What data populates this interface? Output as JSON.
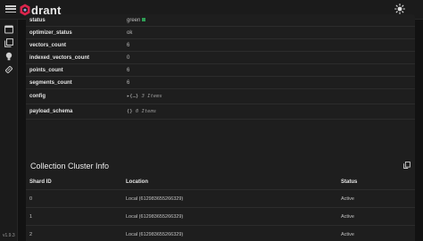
{
  "app": {
    "logo_text": "drant",
    "version": "v1.9.3"
  },
  "colors": {
    "accent": "#dc244c",
    "status_green": "#2e9e55"
  },
  "icons": [
    "menu-icon",
    "qdrant-logo",
    "sun-icon",
    "console-icon",
    "collections-icon",
    "tutorial-icon",
    "datasets-icon",
    "copy-icon"
  ],
  "collection_info": [
    {
      "key": "status",
      "value": "green",
      "indicator": "green-dot"
    },
    {
      "key": "optimizer_status",
      "value": "ok"
    },
    {
      "key": "vectors_count",
      "value": "6"
    },
    {
      "key": "indexed_vectors_count",
      "value": "0"
    },
    {
      "key": "points_count",
      "value": "6"
    },
    {
      "key": "segments_count",
      "value": "6"
    },
    {
      "key": "config",
      "value_prefix": "▸{…}",
      "value_suffix": "3 Items"
    },
    {
      "key": "payload_schema",
      "value_prefix": "{}",
      "value_suffix": "0 Items"
    }
  ],
  "cluster": {
    "title": "Collection Cluster Info",
    "columns": [
      "Shard ID",
      "Location",
      "Status"
    ],
    "rows": [
      {
        "shard": "0",
        "location": "Local (612983655266329)",
        "status": "Active"
      },
      {
        "shard": "1",
        "location": "Local (612983655266329)",
        "status": "Active"
      },
      {
        "shard": "2",
        "location": "Local (612983655266329)",
        "status": "Active"
      }
    ]
  }
}
